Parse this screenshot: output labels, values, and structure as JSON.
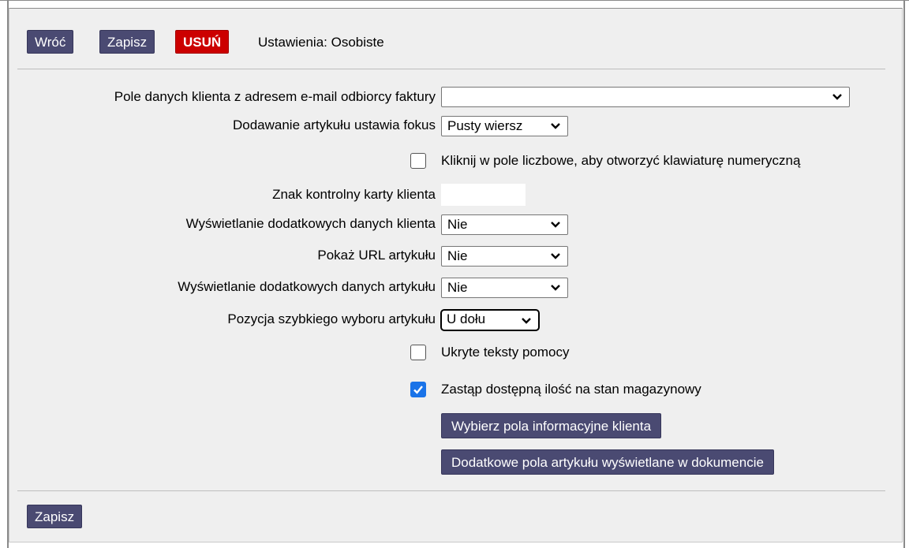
{
  "toolbar": {
    "back_label": "Wróć",
    "save_label": "Zapisz",
    "delete_label": "USUŃ",
    "title": "Ustawienia: Osobiste"
  },
  "colors": {
    "button_dark": "#4a4a72",
    "button_red": "#cc0000",
    "checkbox_checked": "#1a73e8",
    "panel_bg": "#efefef"
  },
  "form": {
    "email_field_label": "Pole danych klienta z adresem e-mail odbiorcy faktury",
    "email_field_value": "",
    "focus_label": "Dodawanie artykułu ustawia fokus",
    "focus_value": "Pusty wiersz",
    "numeric_keyboard_label": "Kliknij w pole liczbowe, aby otworzyć klawiaturę numeryczną",
    "numeric_keyboard_checked": false,
    "card_check_label": "Znak kontrolny karty klienta",
    "card_check_value": "",
    "extra_customer_label": "Wyświetlanie dodatkowych danych klienta",
    "extra_customer_value": "Nie",
    "show_url_label": "Pokaż URL artykułu",
    "show_url_value": "Nie",
    "extra_article_label": "Wyświetlanie dodatkowych danych artykułu",
    "extra_article_value": "Nie",
    "quick_pick_label": "Pozycja szybkiego wyboru artykułu",
    "quick_pick_value": "U dołu",
    "hide_help_label": "Ukryte teksty pomocy",
    "hide_help_checked": false,
    "replace_qty_label": "Zastąp dostępną ilość na stan magazynowy",
    "replace_qty_checked": true,
    "choose_customer_fields_label": "Wybierz pola informacyjne klienta",
    "article_fields_label": "Dodatkowe pola artykułu wyświetlane w dokumencie"
  },
  "footer": {
    "save_label": "Zapisz"
  }
}
